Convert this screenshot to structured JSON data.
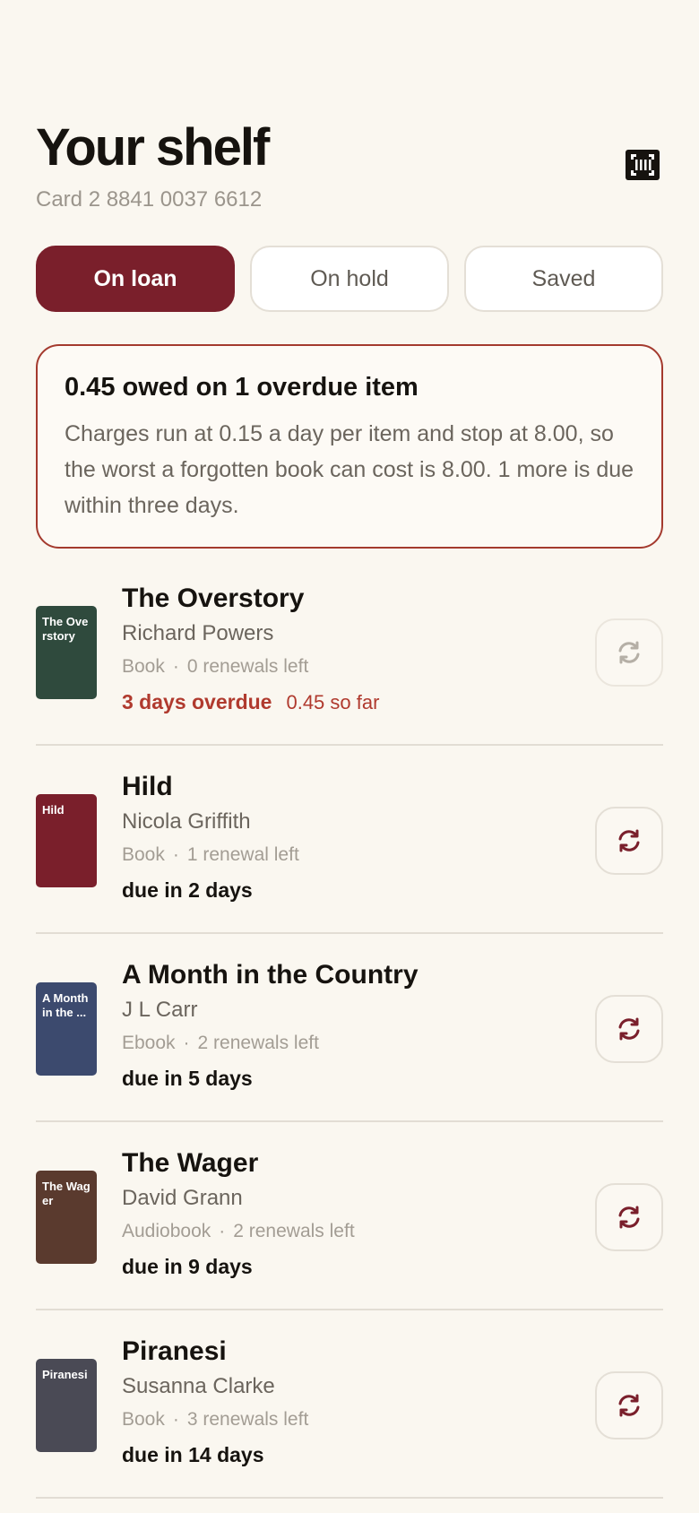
{
  "header": {
    "title": "Your shelf",
    "card_number": "Card 2 8841 0037 6612",
    "scan_icon": "barcode-scan-icon"
  },
  "tabs": [
    {
      "label": "On loan",
      "active": true
    },
    {
      "label": "On hold",
      "active": false
    },
    {
      "label": "Saved",
      "active": false
    }
  ],
  "notice": {
    "title": "0.45 owed on 1 overdue item",
    "body": "Charges run at 0.15 a day per item and stop at 8.00, so the worst a forgotten book can cost is 8.00. 1 more is due within three days."
  },
  "loans": [
    {
      "cover_text": "The Overstory",
      "cover_color": "#2f4a3d",
      "title": "The Overstory",
      "author": "Richard Powers",
      "format": "Book",
      "separator": "·",
      "renewals": "0 renewals left",
      "due": "3 days overdue",
      "fine": "0.45 so far",
      "overdue": true,
      "renew_enabled": false
    },
    {
      "cover_text": "Hild",
      "cover_color": "#7a1f2b",
      "title": "Hild",
      "author": "Nicola Griffith",
      "format": "Book",
      "separator": "·",
      "renewals": "1 renewal left",
      "due": "due in 2 days",
      "fine": "",
      "overdue": false,
      "renew_enabled": true
    },
    {
      "cover_text": "A Month in the ...",
      "cover_color": "#3c4a6e",
      "title": "A Month in the Country",
      "author": "J L Carr",
      "format": "Ebook",
      "separator": "·",
      "renewals": "2 renewals left",
      "due": "due in 5 days",
      "fine": "",
      "overdue": false,
      "renew_enabled": true
    },
    {
      "cover_text": "The Wager",
      "cover_color": "#5a3a2e",
      "title": "The Wager",
      "author": "David Grann",
      "format": "Audiobook",
      "separator": "·",
      "renewals": "2 renewals left",
      "due": "due in 9 days",
      "fine": "",
      "overdue": false,
      "renew_enabled": true
    },
    {
      "cover_text": "Piranesi",
      "cover_color": "#4a4a55",
      "title": "Piranesi",
      "author": "Susanna Clarke",
      "format": "Book",
      "separator": "·",
      "renewals": "3 renewals left",
      "due": "due in 14 days",
      "fine": "",
      "overdue": false,
      "renew_enabled": true
    }
  ],
  "colors": {
    "accent": "#7a1f2b",
    "overdue": "#b03a2e",
    "background": "#faf7f0",
    "renew_icon_disabled": "#b5afa6"
  }
}
